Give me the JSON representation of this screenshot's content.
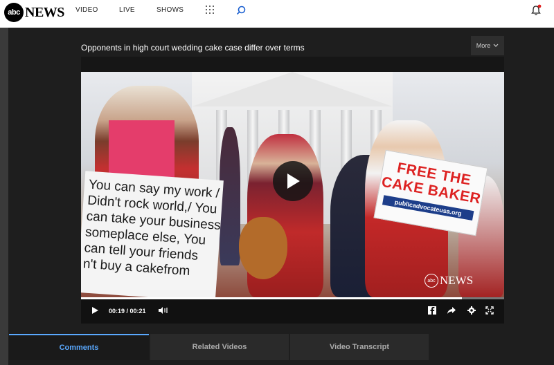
{
  "header": {
    "logo_text": "abc",
    "logo_news": "NEWS",
    "nav": [
      "VIDEO",
      "LIVE",
      "SHOWS"
    ],
    "icons": [
      "grid-icon",
      "search-icon",
      "bell-icon"
    ],
    "notification_dot_color": "#e02020"
  },
  "video": {
    "title": "Opponents in high court wedding cake case differ over terms",
    "more_label": "More",
    "sign_left_lines": [
      "You can say my work /",
      "Didn't rock world,/ You",
      "can take your business",
      "someplace else, You",
      "can tell your friends",
      "n't buy a cakefrom"
    ],
    "sign_right": {
      "line1": "FREE THE",
      "line2": "CAKE BAKER",
      "band": "publicadvocateusa.org"
    },
    "watermark_logo": "abc",
    "watermark_text": "NEWS",
    "progress_fraction": 0.9,
    "time_display": "00:19 / 00:21"
  },
  "tabs": [
    {
      "label": "Comments",
      "active": true
    },
    {
      "label": "Related Videos",
      "active": false
    },
    {
      "label": "Video Transcript",
      "active": false
    }
  ],
  "colors": {
    "accent": "#5aa9ff",
    "sign_red": "#d22222",
    "background": "#1e1e1e"
  }
}
